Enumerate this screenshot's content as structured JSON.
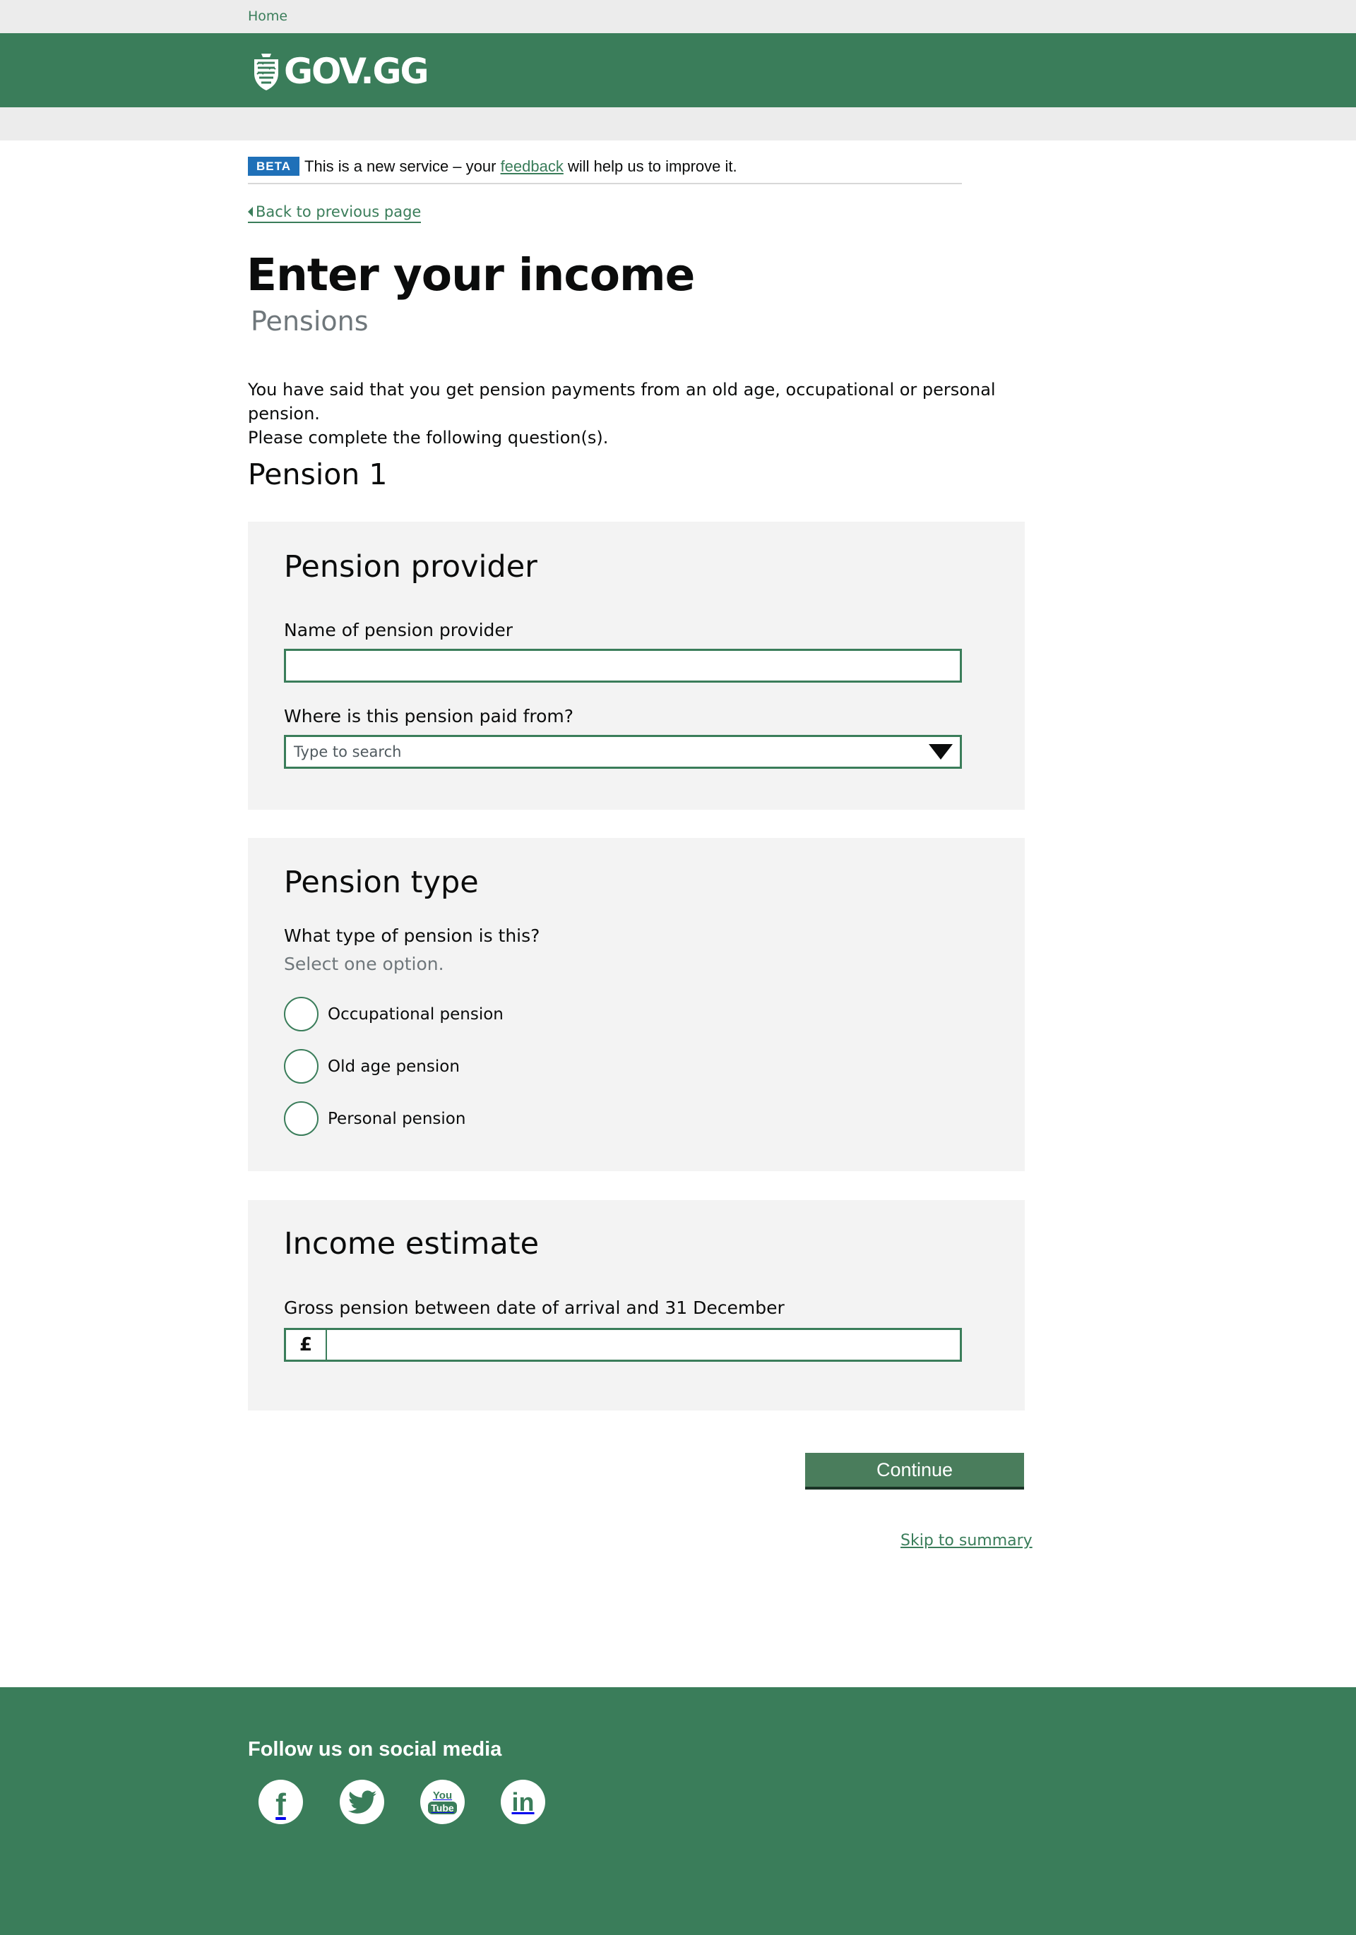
{
  "topbar": {
    "home_link": "Home"
  },
  "header": {
    "logo_text": "GOV.GG"
  },
  "beta": {
    "tag": "BETA",
    "text_before": "This is a new service – your ",
    "link": "feedback",
    "text_after": " will help us to improve it."
  },
  "nav": {
    "back_link": "Back to previous page"
  },
  "page": {
    "title": "Enter your income",
    "caption": "Pensions",
    "intro_line1": "You have said that you get pension payments from an old age, occupational or personal pension.",
    "intro_line2": "Please complete the following question(s).",
    "section_heading": "Pension 1"
  },
  "provider_panel": {
    "heading": "Pension provider",
    "name_label": "Name of pension provider",
    "name_value": "",
    "paid_from_label": "Where is this pension paid from?",
    "paid_from_placeholder": "Type to search"
  },
  "type_panel": {
    "heading": "Pension type",
    "question": "What type of pension is this?",
    "hint": "Select one option.",
    "options": [
      "Occupational pension",
      "Old age pension",
      "Personal pension"
    ]
  },
  "income_panel": {
    "heading": "Income estimate",
    "gross_label": "Gross pension between date of arrival and 31 December",
    "currency_symbol": "£",
    "gross_value": ""
  },
  "actions": {
    "continue_label": "Continue",
    "skip_link": "Skip to summary"
  },
  "footer": {
    "heading": "Follow us on social media",
    "social": [
      "facebook-icon",
      "twitter-icon",
      "youtube-icon",
      "linkedin-icon"
    ],
    "youtube_you": "You",
    "youtube_tube": "Tube",
    "linkedin_text": "in",
    "facebook_text": "f"
  },
  "colors": {
    "brand_green": "#3a7d5a",
    "beta_blue": "#1f70b8",
    "panel_grey": "#f3f3f3"
  }
}
